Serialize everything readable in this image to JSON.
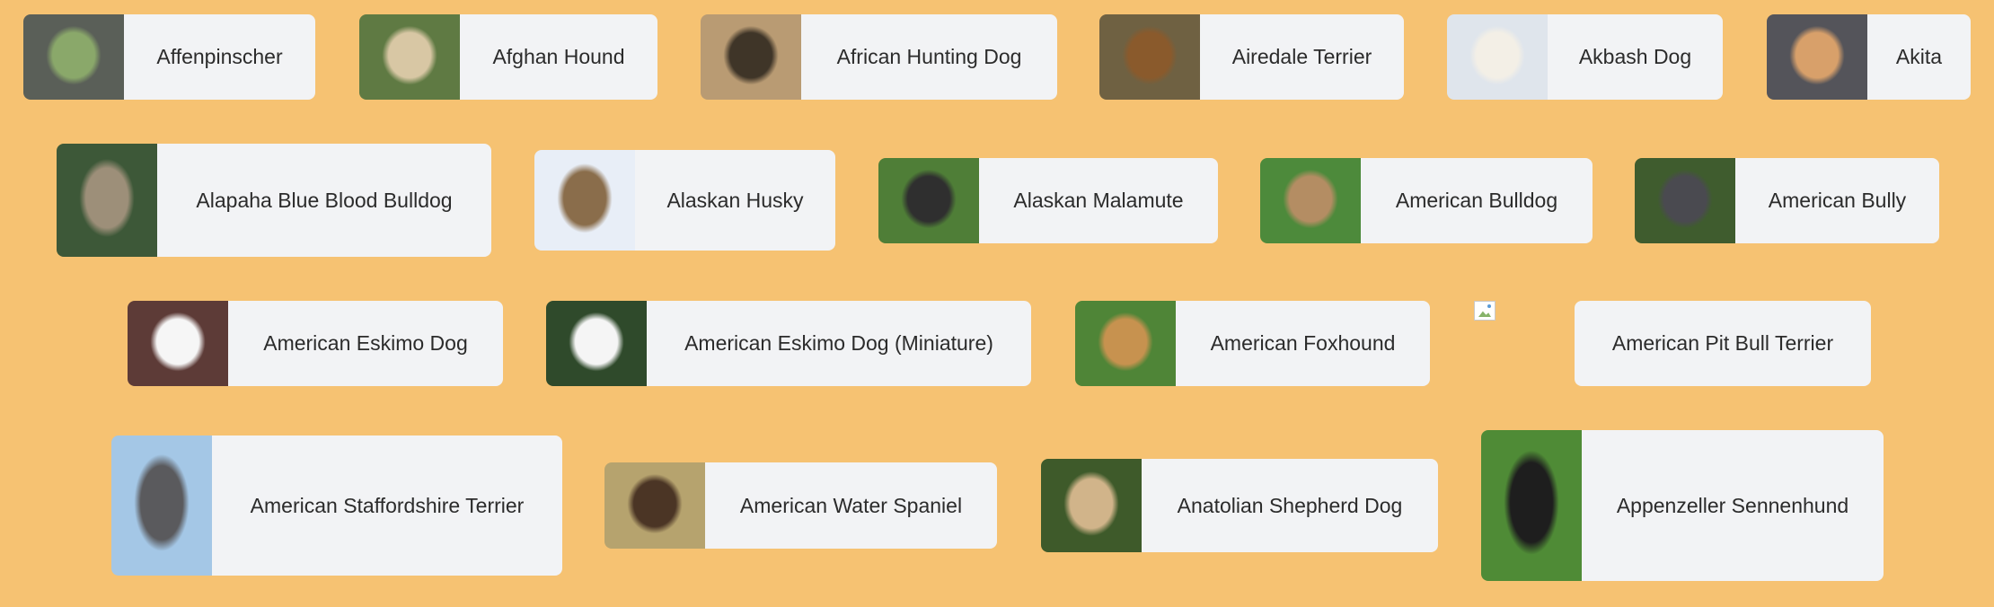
{
  "breeds": [
    {
      "name": "Affenpinscher",
      "colors": [
        "#5a5f58",
        "#8aa86a"
      ]
    },
    {
      "name": "Afghan Hound",
      "colors": [
        "#5f7a43",
        "#d8c7a4"
      ]
    },
    {
      "name": "African Hunting Dog",
      "colors": [
        "#b99b73",
        "#3f3528"
      ]
    },
    {
      "name": "Airedale Terrier",
      "colors": [
        "#6f6142",
        "#8a5a2c"
      ]
    },
    {
      "name": "Akbash Dog",
      "colors": [
        "#dfe5ec",
        "#f3efe6"
      ]
    },
    {
      "name": "Akita",
      "colors": [
        "#54545a",
        "#d8a06a"
      ]
    },
    {
      "name": "Alapaha Blue Blood Bulldog",
      "colors": [
        "#3d5838",
        "#9d8f79"
      ]
    },
    {
      "name": "Alaskan Husky",
      "colors": [
        "#e8eef7",
        "#8a6d4b"
      ]
    },
    {
      "name": "Alaskan Malamute",
      "colors": [
        "#4f7e37",
        "#2f2f2f"
      ]
    },
    {
      "name": "American Bulldog",
      "colors": [
        "#4d8a3b",
        "#b48d63"
      ]
    },
    {
      "name": "American Bully",
      "colors": [
        "#3f5c2e",
        "#4a4a50"
      ]
    },
    {
      "name": "American Eskimo Dog",
      "colors": [
        "#5d3b37",
        "#f6f6f6"
      ]
    },
    {
      "name": "American Eskimo Dog (Miniature)",
      "colors": [
        "#2f4a2b",
        "#f5f5f5"
      ]
    },
    {
      "name": "American Foxhound",
      "colors": [
        "#4f8537",
        "#c7924f"
      ]
    },
    {
      "name": "American Pit Bull Terrier",
      "colors": null
    },
    {
      "name": "American Staffordshire Terrier",
      "colors": [
        "#a4c7e6",
        "#5a5a5d"
      ]
    },
    {
      "name": "American Water Spaniel",
      "colors": [
        "#b6a36e",
        "#4b3525"
      ]
    },
    {
      "name": "Anatolian Shepherd Dog",
      "colors": [
        "#3e5a2a",
        "#d1b48a"
      ]
    },
    {
      "name": "Appenzeller Sennenhund",
      "colors": [
        "#4f8b36",
        "#1e1e1e"
      ]
    }
  ]
}
